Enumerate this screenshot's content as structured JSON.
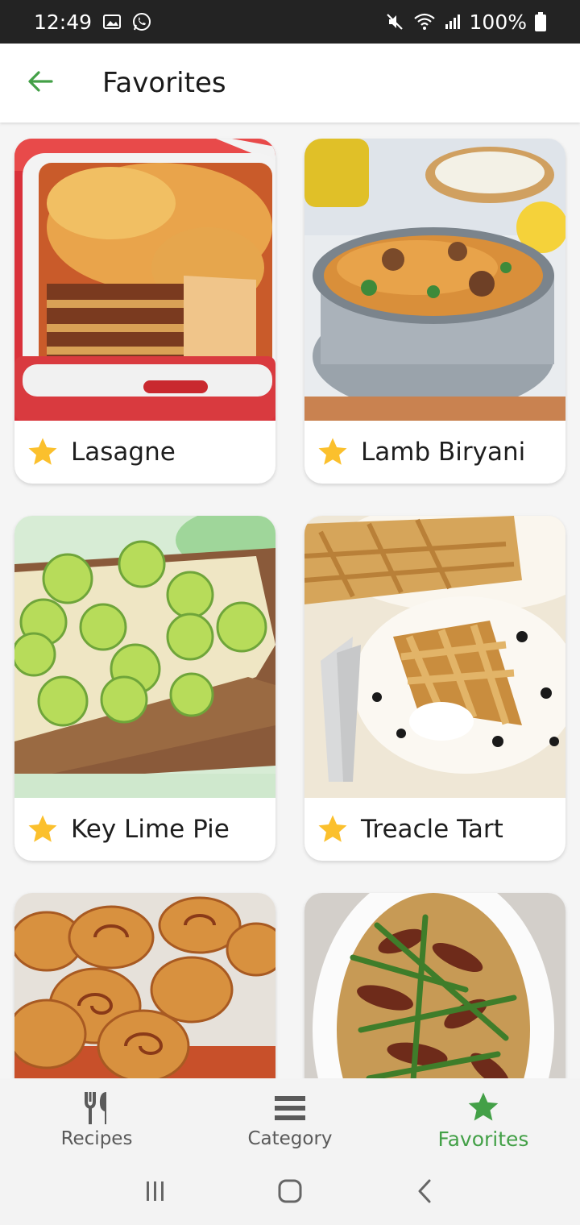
{
  "status_bar": {
    "time": "12:49",
    "battery": "100%",
    "icons": [
      "gallery-icon",
      "whatsapp-icon",
      "mute-icon",
      "wifi-icon",
      "signal-icon",
      "battery-icon"
    ]
  },
  "app_bar": {
    "title": "Favorites",
    "back_icon": "arrow-left-icon"
  },
  "recipes": [
    {
      "name": "Lasagne",
      "favorite": true
    },
    {
      "name": "Lamb Biryani",
      "favorite": true
    },
    {
      "name": "Key Lime Pie",
      "favorite": true
    },
    {
      "name": "Treacle Tart",
      "favorite": true
    },
    {
      "name": "",
      "favorite": true
    },
    {
      "name": "",
      "favorite": true
    }
  ],
  "bottom_nav": {
    "items": [
      {
        "label": "Recipes",
        "icon": "fork-knife-icon",
        "active": false
      },
      {
        "label": "Category",
        "icon": "list-icon",
        "active": false
      },
      {
        "label": "Favorites",
        "icon": "star-icon",
        "active": true
      }
    ]
  },
  "system_nav": [
    "recent-apps-icon",
    "home-icon",
    "back-icon"
  ],
  "colors": {
    "accent": "#43a047",
    "star": "#fbc02d",
    "status_bar_bg": "#232323",
    "nav_bg": "#f3f3f3"
  }
}
